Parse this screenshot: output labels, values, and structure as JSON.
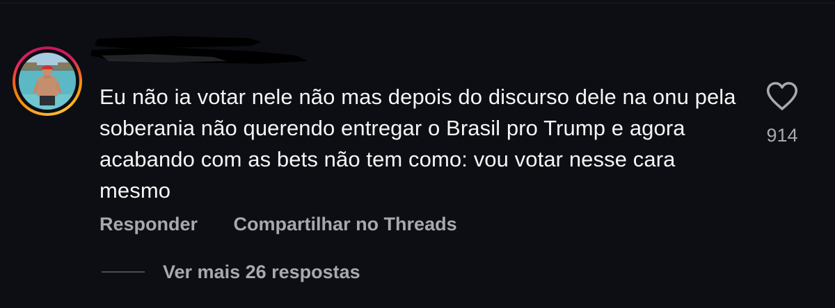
{
  "comment": {
    "text": "Eu não ia votar nele não mas depois do discurso dele na onu pela soberania não querendo entregar o Brasil pro Trump e agora acabando com as bets não tem como: vou votar nesse cara mesmo",
    "like_count": "914",
    "like_icon": "heart-outline-icon",
    "reply_label": "Responder",
    "share_label": "Compartilhar no Threads",
    "more_replies_label": "Ver mais 26 respostas"
  },
  "colors": {
    "background": "#0c0e13",
    "text": "#f5f5f5",
    "secondary": "#a8a8ad"
  }
}
